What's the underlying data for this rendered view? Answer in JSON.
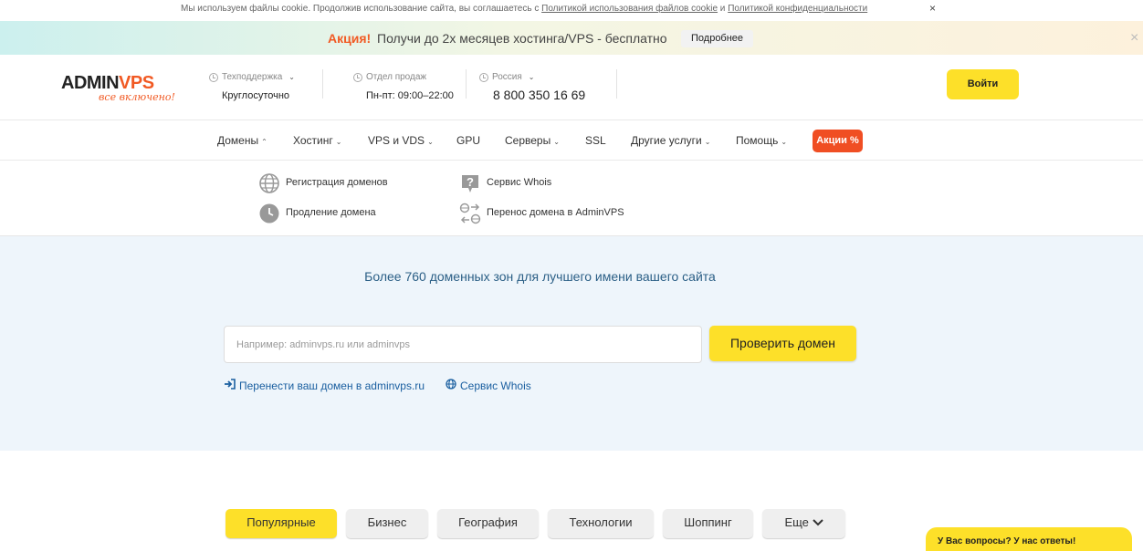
{
  "cookie": {
    "text": "Мы используем файлы cookie. Продолжив использование сайта, вы соглашаетесь с ",
    "link1": "Политикой использования файлов cookie",
    "and": " и ",
    "link2": "Политикой конфиденциальности",
    "close": "×"
  },
  "promo": {
    "label": "Акция!",
    "text": "Получи до 2х месяцев хостинга/VPS - бесплатно",
    "button": "Подробнее",
    "close": "×"
  },
  "header": {
    "logo": "ADMINVPS",
    "logo_tagline": "все включено!",
    "support": {
      "label": "Техподдержка",
      "value": "Круглосуточно"
    },
    "sales": {
      "label": "Отдел продаж",
      "value": "Пн-пт: 09:00–22:00"
    },
    "region": {
      "label": "Россия",
      "phone": "8 800 350 16 69"
    },
    "login": "Войти"
  },
  "nav": {
    "items": [
      "Домены",
      "Хостинг",
      "VPS и VDS",
      "GPU",
      "Серверы",
      "SSL",
      "Другие услуги",
      "Помощь"
    ],
    "promo": "Акции %"
  },
  "dropdown": {
    "items": [
      "Регистрация доменов",
      "Продление домена",
      "Сервис Whois",
      "Перенос домена в AdminVPS"
    ]
  },
  "hero": {
    "title": "Более 760 доменных зон для лучшего имени вашего сайта",
    "placeholder": "Например: adminvps.ru или adminvps",
    "button": "Проверить домен",
    "link_transfer": "Перенести ваш домен в adminvps.ru",
    "link_whois": "Сервис Whois"
  },
  "tabs": [
    "Популярные",
    "Бизнес",
    "География",
    "Технологии",
    "Шоппинг",
    "Еще"
  ],
  "chat": "У Вас вопросы? У нас ответы!",
  "colors": {
    "accent": "#fde029",
    "brand": "#f15a24",
    "link": "#1a5fa0",
    "hero_bg": "#eef5fb"
  }
}
